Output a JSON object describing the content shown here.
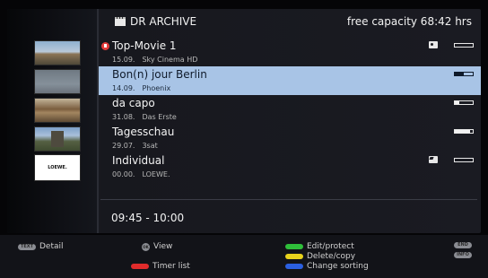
{
  "header": {
    "title": "DR ARCHIVE",
    "capacity": "free capacity 68:42 hrs"
  },
  "thumbnails": [
    {
      "kind": "landscape"
    },
    {
      "kind": "placeholder"
    },
    {
      "kind": "landscape"
    },
    {
      "kind": "castle"
    },
    {
      "kind": "logo",
      "text": "LOEWE."
    }
  ],
  "recordings": [
    {
      "title": "Top-Movie 1",
      "date": "15.09.",
      "channel": "Sky Cinema HD",
      "recording": true,
      "status_icon": "lock-icon",
      "progress": 0.0,
      "selected": false
    },
    {
      "title": "Bon(n) jour Berlin",
      "date": "14.09.",
      "channel": "Phoenix",
      "recording": false,
      "status_icon": "",
      "progress": 0.5,
      "selected": true
    },
    {
      "title": "da capo",
      "date": "31.08.",
      "channel": "Das Erste",
      "recording": false,
      "status_icon": "",
      "progress": 0.25,
      "selected": false
    },
    {
      "title": "Tagesschau",
      "date": "29.07.",
      "channel": "3sat",
      "recording": false,
      "status_icon": "",
      "progress": 0.85,
      "selected": false
    },
    {
      "title": "Individual",
      "date": "00.00.",
      "channel": "LOEWE.",
      "recording": false,
      "status_icon": "clapper-icon",
      "progress": 0.0,
      "selected": false
    }
  ],
  "time_range": "09:45 - 10:00",
  "footer": {
    "detail_key": "TEXT",
    "detail_label": "Detail",
    "ok_key": "OK",
    "view_label": "View",
    "timer_label": "Timer list",
    "edit_label": "Edit/protect",
    "delete_label": "Delete/copy",
    "sort_label": "Change sorting",
    "end_key": "END",
    "info_key": "INFO"
  },
  "colors": {
    "selection": "#a8c4e6",
    "red": "#e02b2b",
    "green": "#2fbf3a",
    "yellow": "#e8d21c",
    "blue": "#2b5fe0"
  }
}
